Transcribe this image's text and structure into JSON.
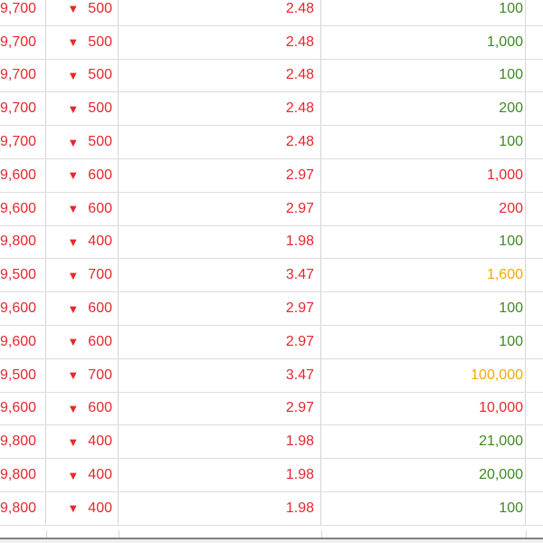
{
  "colors": {
    "down": "#e6272e",
    "up_green": "#3c8a1f",
    "orange": "#f5a900"
  },
  "arrow_icon": "down-triangle-icon",
  "rows": [
    {
      "price": "9,700",
      "change": "500",
      "percent": "2.48",
      "volume": "100",
      "volume_color": "green"
    },
    {
      "price": "9,700",
      "change": "500",
      "percent": "2.48",
      "volume": "1,000",
      "volume_color": "green"
    },
    {
      "price": "9,700",
      "change": "500",
      "percent": "2.48",
      "volume": "100",
      "volume_color": "green"
    },
    {
      "price": "9,700",
      "change": "500",
      "percent": "2.48",
      "volume": "200",
      "volume_color": "green"
    },
    {
      "price": "9,700",
      "change": "500",
      "percent": "2.48",
      "volume": "100",
      "volume_color": "green"
    },
    {
      "price": "9,600",
      "change": "600",
      "percent": "2.97",
      "volume": "1,000",
      "volume_color": "red"
    },
    {
      "price": "9,600",
      "change": "600",
      "percent": "2.97",
      "volume": "200",
      "volume_color": "red"
    },
    {
      "price": "9,800",
      "change": "400",
      "percent": "1.98",
      "volume": "100",
      "volume_color": "green"
    },
    {
      "price": "9,500",
      "change": "700",
      "percent": "3.47",
      "volume": "1,600",
      "volume_color": "orange"
    },
    {
      "price": "9,600",
      "change": "600",
      "percent": "2.97",
      "volume": "100",
      "volume_color": "green"
    },
    {
      "price": "9,600",
      "change": "600",
      "percent": "2.97",
      "volume": "100",
      "volume_color": "green"
    },
    {
      "price": "9,500",
      "change": "700",
      "percent": "3.47",
      "volume": "100,000",
      "volume_color": "orange"
    },
    {
      "price": "9,600",
      "change": "600",
      "percent": "2.97",
      "volume": "10,000",
      "volume_color": "red"
    },
    {
      "price": "9,800",
      "change": "400",
      "percent": "1.98",
      "volume": "21,000",
      "volume_color": "green"
    },
    {
      "price": "9,800",
      "change": "400",
      "percent": "1.98",
      "volume": "20,000",
      "volume_color": "green"
    },
    {
      "price": "9,800",
      "change": "400",
      "percent": "1.98",
      "volume": "100",
      "volume_color": "green"
    }
  ]
}
